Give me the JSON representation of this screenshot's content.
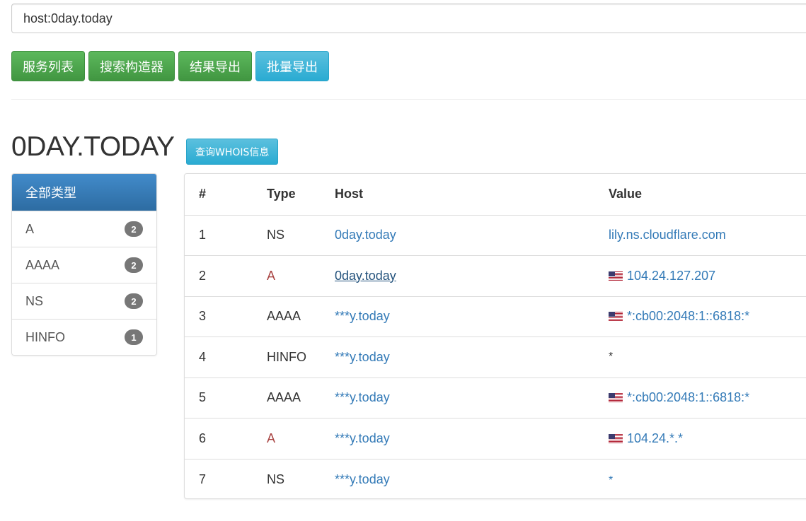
{
  "search": {
    "value": "host:0day.today"
  },
  "buttons": [
    {
      "label": "服务列表",
      "style": "green"
    },
    {
      "label": "搜索构造器",
      "style": "green"
    },
    {
      "label": "结果导出",
      "style": "green"
    },
    {
      "label": "批量导出",
      "style": "blue"
    }
  ],
  "page": {
    "title": "0DAY.TODAY",
    "whois_label": "查询WHOIS信息"
  },
  "sidebar": {
    "items": [
      {
        "label": "全部类型",
        "count": null,
        "active": true
      },
      {
        "label": "A",
        "count": "2"
      },
      {
        "label": "AAAA",
        "count": "2"
      },
      {
        "label": "NS",
        "count": "2"
      },
      {
        "label": "HINFO",
        "count": "1"
      }
    ]
  },
  "table": {
    "headers": [
      "#",
      "Type",
      "Host",
      "Value"
    ],
    "rows": [
      {
        "num": "1",
        "type": "NS",
        "host": "0day.today",
        "value": "lily.ns.cloudflare.com",
        "flag": false
      },
      {
        "num": "2",
        "type": "A",
        "host": "0day.today",
        "value": "104.24.127.207",
        "flag": true
      },
      {
        "num": "3",
        "type": "AAAA",
        "host": "***y.today",
        "value": "*:cb00:2048:1::6818:*",
        "flag": true
      },
      {
        "num": "4",
        "type": "HINFO",
        "host": "***y.today",
        "value": "*",
        "flag": false
      },
      {
        "num": "5",
        "type": "AAAA",
        "host": "***y.today",
        "value": "*:cb00:2048:1::6818:*",
        "flag": true
      },
      {
        "num": "6",
        "type": "A",
        "host": "***y.today",
        "value": "104.24.*.*",
        "flag": true
      },
      {
        "num": "7",
        "type": "NS",
        "host": "***y.today",
        "value": "*",
        "flag": false
      }
    ]
  },
  "colors": {
    "link": "#337ab7",
    "type_a": "#a94442",
    "btn_green": "#5cb85c",
    "btn_blue": "#5bc0de",
    "sidebar_active": "#337ab7",
    "badge": "#777777"
  },
  "icons": {
    "flag": "us-flag-icon"
  }
}
